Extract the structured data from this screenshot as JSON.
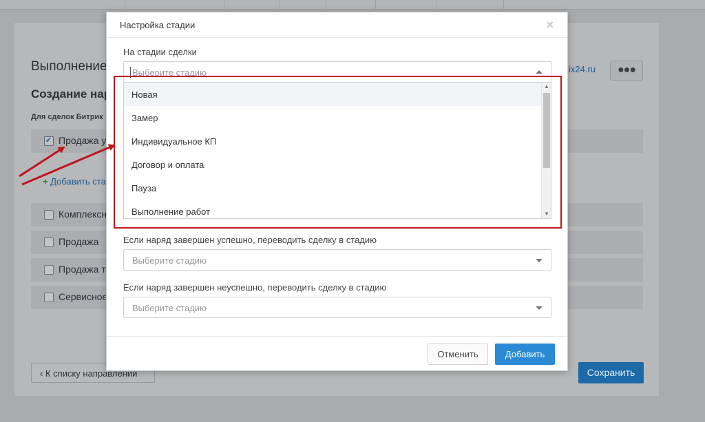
{
  "background": {
    "title": "Выполнение",
    "subtitle": "Создание нар",
    "caption": "Для сделок Битрик",
    "checked_item": "Продажа у",
    "add_link": "Добавить ста",
    "link_text": "ix24.ru",
    "more_icon": "ellipsis-icon",
    "items": [
      "Комплексн",
      "Продажа",
      "Продажа т",
      "Сервисное"
    ],
    "back_button": "К списку направлений",
    "save_button": "Сохранить"
  },
  "modal": {
    "title": "Настройка стадии",
    "close_icon": "close-icon",
    "field1": {
      "label": "На стадии сделки",
      "placeholder": "Выберите стадию",
      "options": [
        "Новая",
        "Замер",
        "Индивидуальное КП",
        "Договор и оплата",
        "Пауза",
        "Выполнение работ"
      ]
    },
    "field2": {
      "label": "Если наряд завершен успешно, переводить сделку в стадию",
      "placeholder": "Выберите стадию"
    },
    "field3": {
      "label": "Если наряд завершен неуспешно, переводить сделку в стадию",
      "placeholder": "Выберите стадию"
    },
    "cancel_button": "Отменить",
    "add_button": "Добавить"
  },
  "colors": {
    "accent": "#2a8ad5",
    "annotation": "#c0141b"
  }
}
